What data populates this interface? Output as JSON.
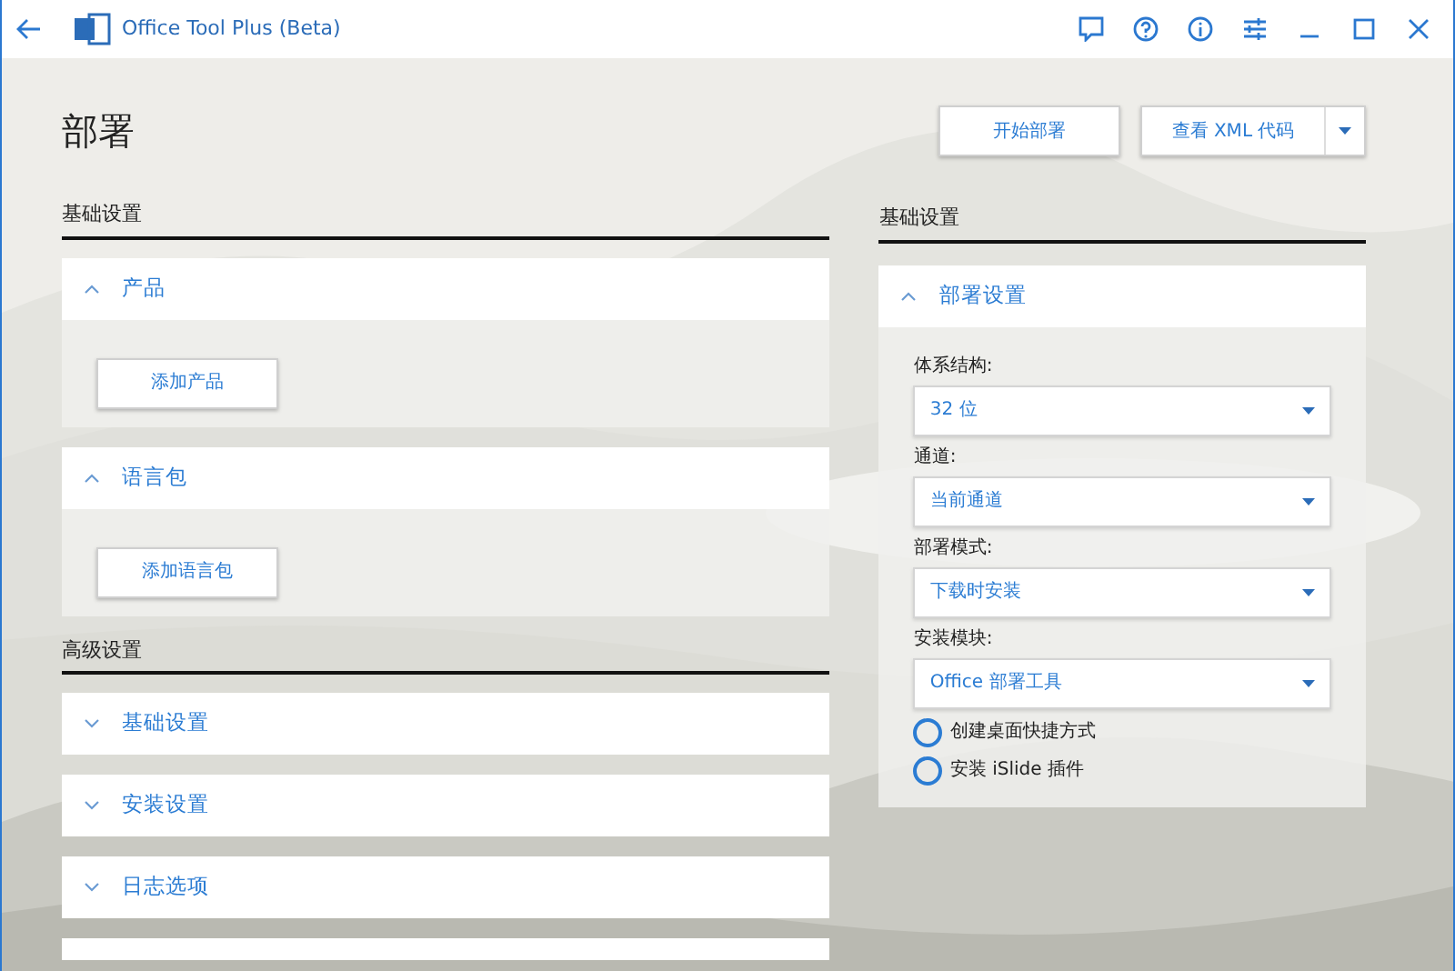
{
  "window": {
    "title": "Office Tool Plus (Beta)"
  },
  "page_title": "部署",
  "actions": {
    "primary": "开始部署",
    "split": "查看 XML 代码"
  },
  "left": {
    "sections": [
      {
        "heading": "基础设置",
        "panels": [
          {
            "title": "产品",
            "expanded": true,
            "button": "添加产品"
          },
          {
            "title": "语言包",
            "expanded": true,
            "button": "添加语言包"
          }
        ]
      },
      {
        "heading": "高级设置",
        "panels": [
          {
            "title": "基础设置",
            "expanded": false
          },
          {
            "title": "安装设置",
            "expanded": false
          },
          {
            "title": "日志选项",
            "expanded": false
          },
          {
            "kind": "stub"
          }
        ]
      }
    ]
  },
  "right": {
    "heading": "基础设置",
    "panel": {
      "title": "部署设置",
      "expanded": true,
      "fields": [
        {
          "label": "体系结构:",
          "value": "32 位"
        },
        {
          "label": "通道:",
          "value": "当前通道"
        },
        {
          "label": "部署模式:",
          "value": "下载时安装"
        },
        {
          "label": "安装模块:",
          "value": "Office 部署工具"
        }
      ],
      "options": [
        {
          "label": "创建桌面快捷方式",
          "checked": false
        },
        {
          "label": "安装 iSlide 插件",
          "checked": false
        }
      ]
    }
  }
}
